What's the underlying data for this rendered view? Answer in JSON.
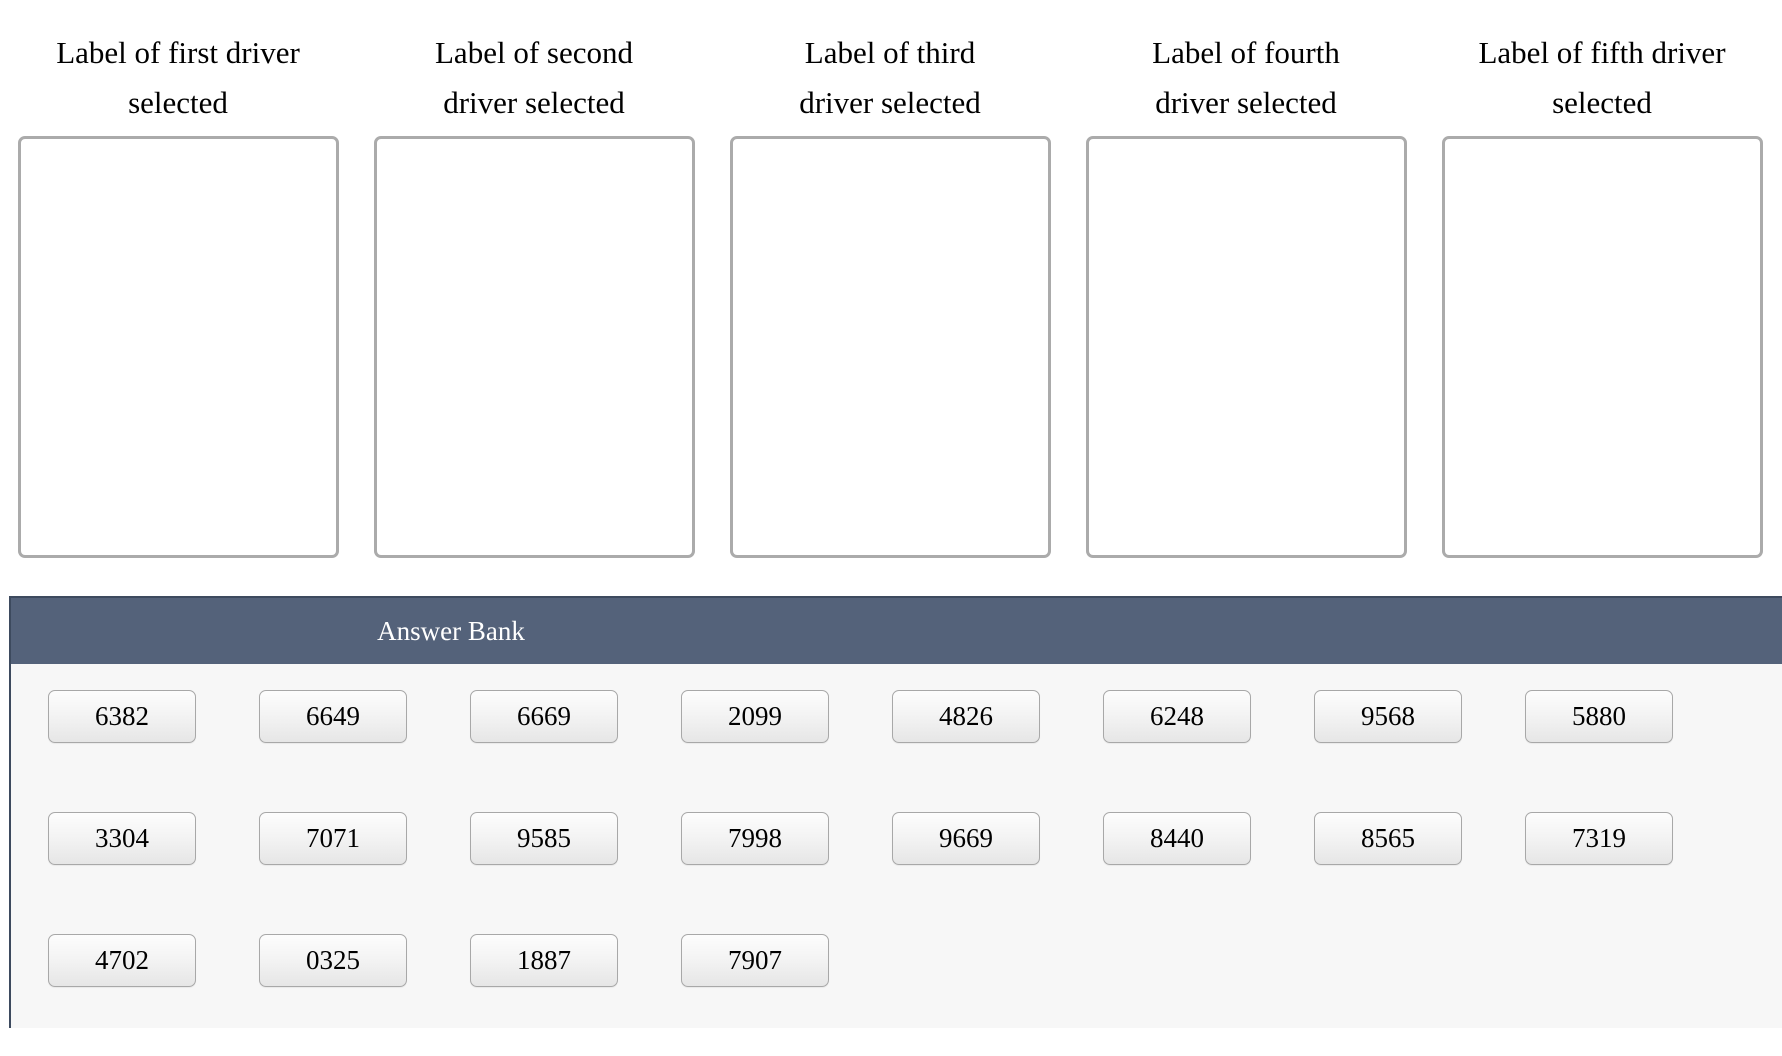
{
  "dropzones": [
    {
      "label": "Label of first driver selected",
      "value": ""
    },
    {
      "label": "Label of second driver selected",
      "value": ""
    },
    {
      "label": "Label of third driver selected",
      "value": ""
    },
    {
      "label": "Label of fourth driver selected",
      "value": ""
    },
    {
      "label": "Label of fifth driver selected",
      "value": ""
    }
  ],
  "answer_bank": {
    "title": "Answer Bank",
    "header_color": "#54627a",
    "panel_border_color": "#3d4a5e",
    "body_color": "#f7f7f7",
    "rows": [
      [
        "6382",
        "6649",
        "6669",
        "2099",
        "4826",
        "6248",
        "9568",
        "5880"
      ],
      [
        "3304",
        "7071",
        "9585",
        "7998",
        "9669",
        "8440",
        "8565",
        "7319"
      ],
      [
        "4702",
        "0325",
        "1887",
        "7907"
      ]
    ]
  }
}
